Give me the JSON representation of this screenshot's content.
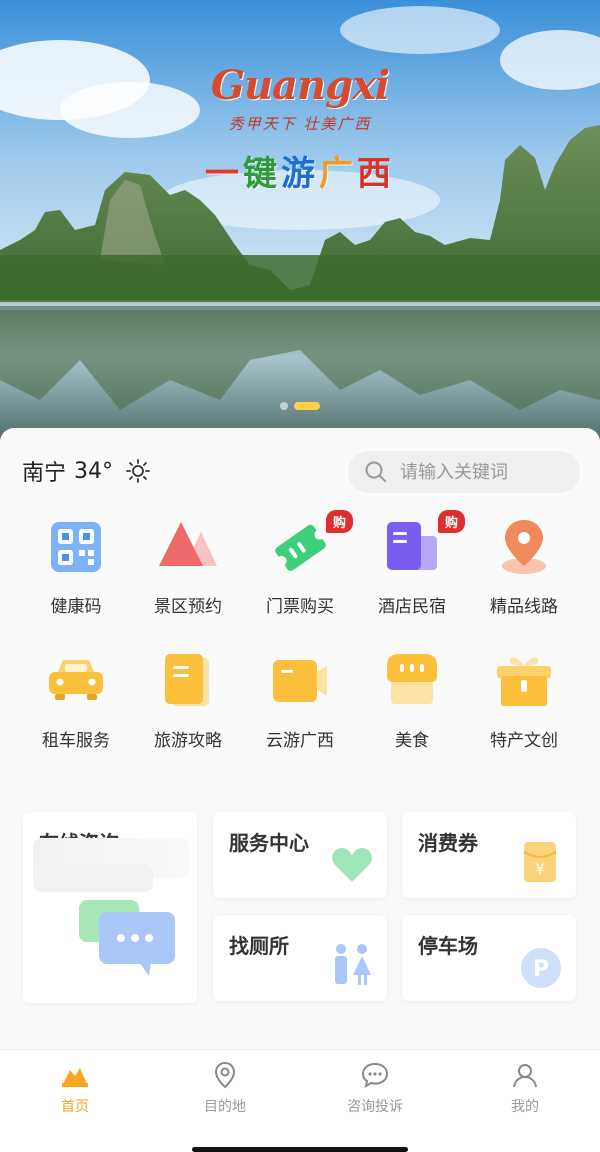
{
  "banner": {
    "logo_text": "Guangxi",
    "logo_sub": "秀甲天下 壮美广西",
    "slogan": [
      "一",
      "键",
      "游",
      "广",
      "西"
    ],
    "slogan_colors": [
      "#e8362c",
      "#2e9a3a",
      "#1c6fd1",
      "#f29b1d",
      "#d8332a"
    ],
    "dots": 2,
    "active_dot": 1
  },
  "header": {
    "city": "南宁",
    "temperature": "34°",
    "weather_icon": "sun-icon",
    "search_placeholder": "请输入关键词"
  },
  "grid": [
    {
      "id": "health-code",
      "label": "健康码",
      "icon": "qr-code-icon",
      "badge": ""
    },
    {
      "id": "scenic-booking",
      "label": "景区预约",
      "icon": "mountain-icon",
      "badge": ""
    },
    {
      "id": "ticket-buy",
      "label": "门票购买",
      "icon": "ticket-icon",
      "badge": "购"
    },
    {
      "id": "hotel",
      "label": "酒店民宿",
      "icon": "hotel-icon",
      "badge": "购"
    },
    {
      "id": "routes",
      "label": "精品线路",
      "icon": "location-pin-icon",
      "badge": ""
    },
    {
      "id": "car-rental",
      "label": "租车服务",
      "icon": "car-icon",
      "badge": ""
    },
    {
      "id": "guide",
      "label": "旅游攻略",
      "icon": "book-icon",
      "badge": ""
    },
    {
      "id": "cloud-tour",
      "label": "云游广西",
      "icon": "video-camera-icon",
      "badge": ""
    },
    {
      "id": "food",
      "label": "美食",
      "icon": "food-stall-icon",
      "badge": ""
    },
    {
      "id": "specialty",
      "label": "特产文创",
      "icon": "gift-box-icon",
      "badge": ""
    }
  ],
  "services": {
    "consult": "在线咨询",
    "service_center": "服务中心",
    "coupon": "消费券",
    "toilet": "找厕所",
    "parking": "停车场"
  },
  "tabs": [
    {
      "id": "home",
      "label": "首页",
      "icon": "mountain-home-icon",
      "active": true
    },
    {
      "id": "destination",
      "label": "目的地",
      "icon": "map-pin-icon",
      "active": false
    },
    {
      "id": "complaint",
      "label": "咨询投诉",
      "icon": "chat-bubble-icon",
      "active": false
    },
    {
      "id": "mine",
      "label": "我的",
      "icon": "user-icon",
      "active": false
    }
  ],
  "colors": {
    "accent": "#f5a623",
    "badge": "#e02d2d"
  }
}
